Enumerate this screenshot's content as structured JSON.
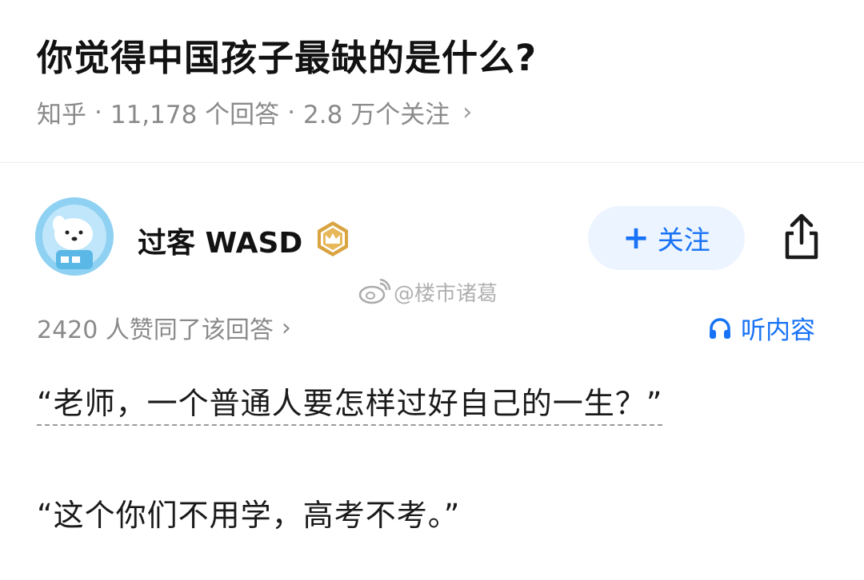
{
  "question": {
    "title": "你觉得中国孩子最缺的是什么?",
    "source": "知乎",
    "answer_count": "11,178 个回答",
    "follower_count": "2.8 万个关注"
  },
  "answer": {
    "author_name": "过客 WASD",
    "follow_label": "关注",
    "watermark": "@楼市诸葛",
    "votes_text": "2420 人赞同了该回答",
    "listen_label": "听内容",
    "paragraphs": [
      "“老师，一个普通人要怎样过好自己的一生？”",
      "“这个你们不用学，高考不考。”"
    ]
  },
  "colors": {
    "accent": "#1772f6",
    "follow_bg": "#ebf4ff",
    "meta_gray": "#8a8a8a",
    "badge_gold": "#d9a441"
  },
  "icons": [
    "chevron-right-icon",
    "avatar-image",
    "crown-badge-icon",
    "plus-icon",
    "share-icon",
    "weibo-icon",
    "headphones-icon"
  ]
}
